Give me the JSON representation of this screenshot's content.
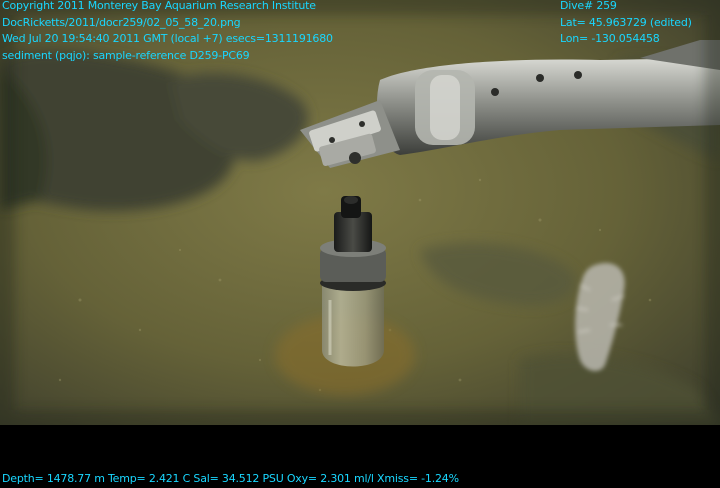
{
  "overlay": {
    "top_left": [
      "Copyright 2011 Monterey Bay Aquarium Research Institute",
      "DocRicketts/2011/docr259/02_05_58_20.png",
      "Wed Jul 20 19:54:40 2011 GMT (local +7)  esecs=1311191680",
      "sediment (pqjo): sample-reference D259-PC69"
    ],
    "top_right": [
      "Dive# 259",
      "Lat= 45.963729 (edited)",
      "Lon= -130.054458"
    ],
    "bottom": "Depth= 1478.77 m  Temp= 2.421 C  Sal= 34.512 PSU  Oxy= 2.301 ml/l  Xmiss= -1.24%"
  },
  "colors": {
    "overlay_text": "#19d7ff",
    "seafloor": "#6e6a3c",
    "water_dark": "#2f3325"
  },
  "scene": {
    "subjects": [
      "robotic-arm-manipulator",
      "push-core-sampler",
      "sea-cucumber",
      "sediment-seafloor"
    ]
  }
}
